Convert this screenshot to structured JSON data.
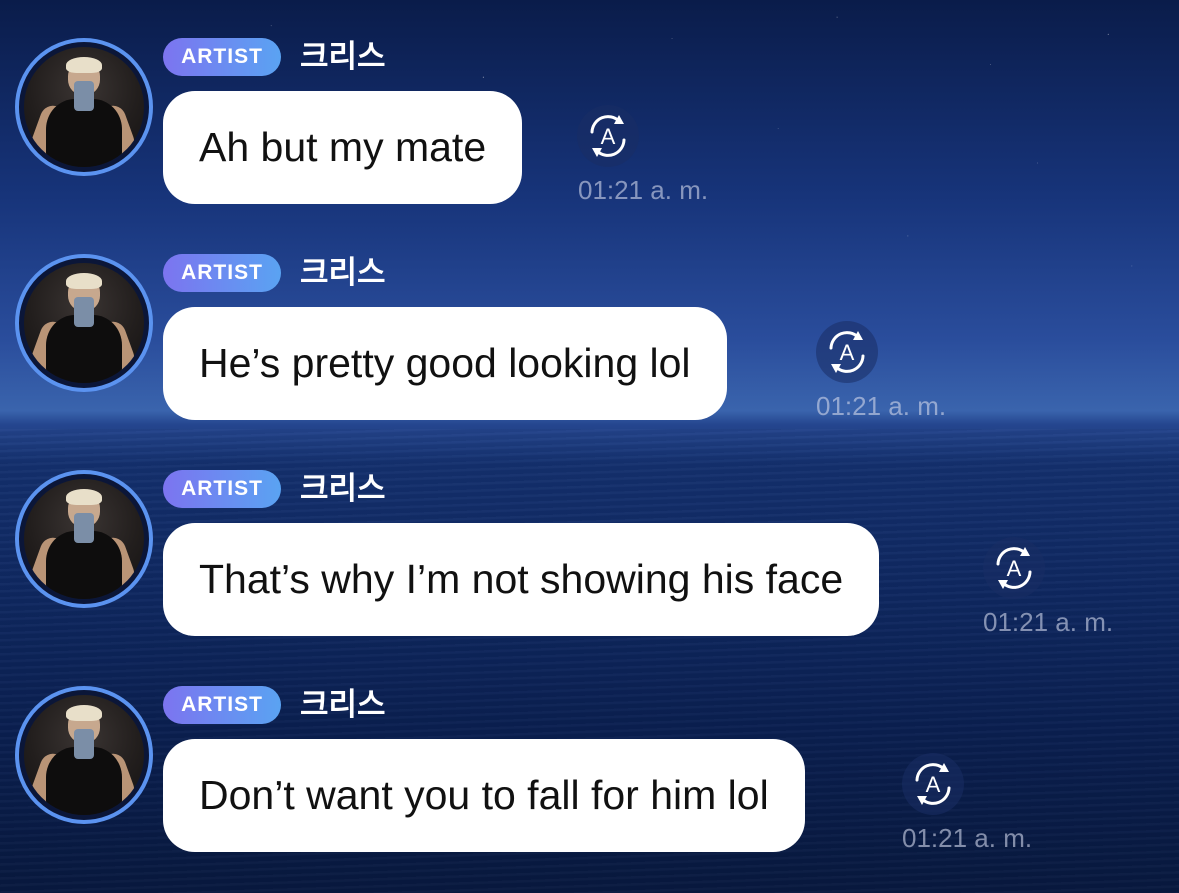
{
  "messages": [
    {
      "badge": "ARTIST",
      "sender": "크리스",
      "text": "Ah but my mate",
      "time": "01:21 a. m.",
      "avatar_icon": "profile-photo",
      "translate_icon": "auto-translate-icon"
    },
    {
      "badge": "ARTIST",
      "sender": "크리스",
      "text": "He’s pretty good looking lol",
      "time": "01:21 a. m.",
      "avatar_icon": "profile-photo",
      "translate_icon": "auto-translate-icon"
    },
    {
      "badge": "ARTIST",
      "sender": "크리스",
      "text": "That’s why I’m not showing his face",
      "time": "01:21 a. m.",
      "avatar_icon": "profile-photo",
      "translate_icon": "auto-translate-icon"
    },
    {
      "badge": "ARTIST",
      "sender": "크리스",
      "text": "Don’t want you to fall for him lol",
      "time": "01:21 a. m.",
      "avatar_icon": "profile-photo",
      "translate_icon": "auto-translate-icon"
    }
  ],
  "colors": {
    "badge_gradient_start": "#7c74f0",
    "badge_gradient_end": "#5aa3f2",
    "avatar_ring": "#5b93f0",
    "bubble": "#ffffff",
    "bubble_text": "#111111",
    "timestamp": "#cdd4e8"
  }
}
